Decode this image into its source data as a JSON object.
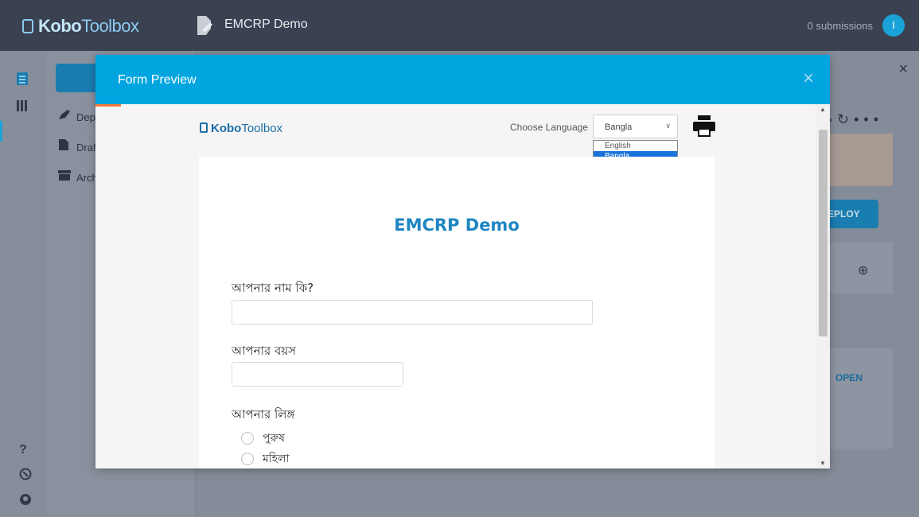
{
  "topbar": {
    "logo_light": "Kobo",
    "logo_rest": "Toolbox",
    "project_name": "EMCRP Demo",
    "submissions": "0 submissions",
    "avatar_initial": "I"
  },
  "sidebar": {
    "links": [
      {
        "label": "Dep",
        "icon": "rocket-icon"
      },
      {
        "label": "Draf",
        "icon": "draft-icon"
      },
      {
        "label": "Arch",
        "icon": "archive-icon"
      }
    ]
  },
  "background": {
    "deploy_label": "EPLOY",
    "open_label": "OPEN",
    "close_glyph": "×"
  },
  "modal": {
    "title": "Form Preview",
    "close_glyph": "×"
  },
  "preview": {
    "logo_bold": "Kobo",
    "logo_rest": "Toolbox",
    "language_label": "Choose Language",
    "language_selected": "Bangla",
    "language_options": [
      "English",
      "Bangla"
    ],
    "form_title": "EMCRP Demo",
    "questions": [
      {
        "label": "আপনার নাম কি?",
        "type": "text"
      },
      {
        "label": "আপনার বয়স",
        "type": "integer"
      },
      {
        "label": "আপনার লিঙ্গ",
        "type": "select_one",
        "options": [
          "পুরুষ",
          "মহিলা"
        ]
      }
    ]
  },
  "colors": {
    "modal_header": "#00a5e0",
    "title_blue": "#1f86c2",
    "topbar": "#3a4151"
  }
}
